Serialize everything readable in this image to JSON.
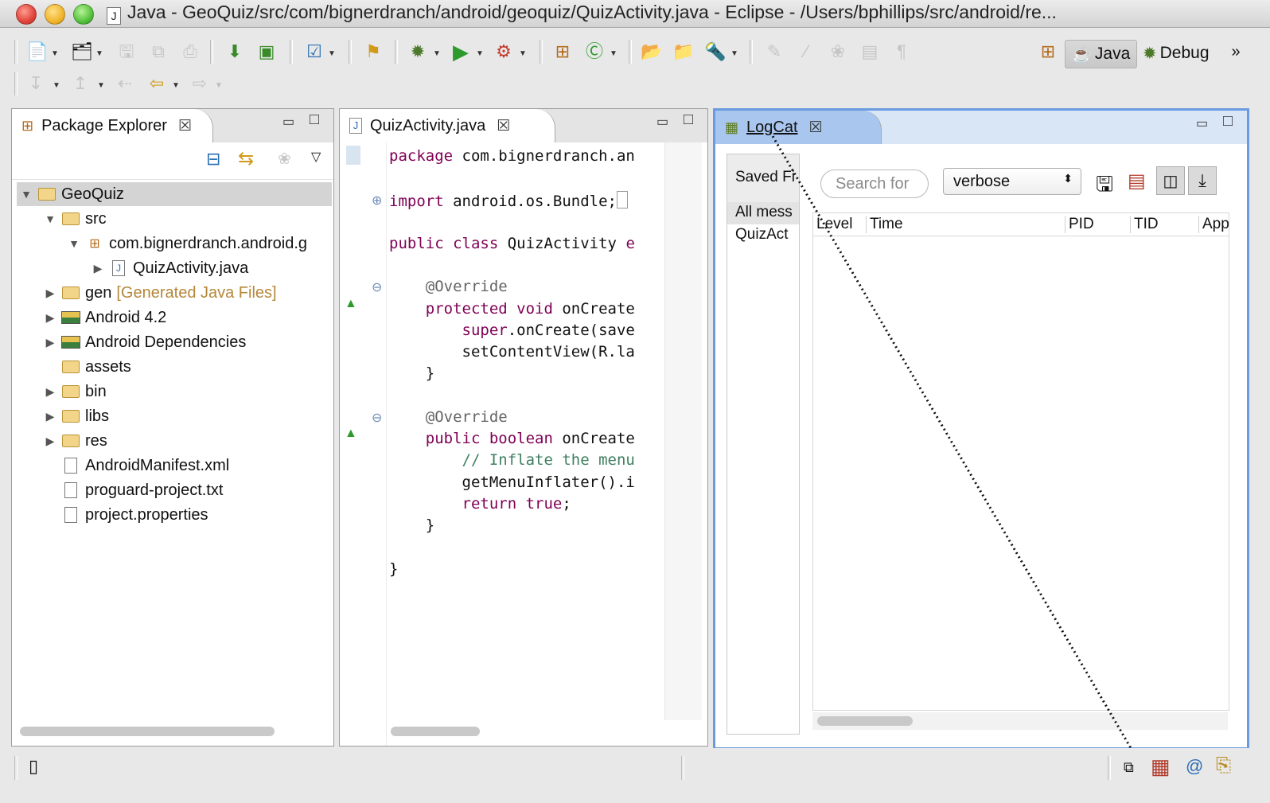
{
  "window": {
    "title": "Java - GeoQuiz/src/com/bignerdranch/android/geoquiz/QuizActivity.java - Eclipse -  /Users/bphillips/src/android/re..."
  },
  "perspectives": [
    {
      "label": "Java",
      "active": true
    },
    {
      "label": "Debug",
      "active": false
    }
  ],
  "perspective_overflow": "»",
  "package_explorer": {
    "tab_label": "Package Explorer",
    "tree": [
      {
        "label": "GeoQuiz",
        "depth": 0,
        "expanded": true,
        "icon": "project-icon",
        "selected": true
      },
      {
        "label": "src",
        "depth": 1,
        "expanded": true,
        "icon": "source-folder-icon"
      },
      {
        "label": "com.bignerdranch.android.g",
        "depth": 2,
        "expanded": true,
        "icon": "package-icon"
      },
      {
        "label": "QuizActivity.java",
        "depth": 3,
        "expanded": false,
        "icon": "java-file-icon"
      },
      {
        "label": "gen",
        "suffix": "[Generated Java Files]",
        "depth": 1,
        "expanded": false,
        "icon": "source-folder-icon"
      },
      {
        "label": "Android 4.2",
        "depth": 1,
        "expanded": false,
        "icon": "library-icon"
      },
      {
        "label": "Android Dependencies",
        "depth": 1,
        "expanded": false,
        "icon": "library-icon"
      },
      {
        "label": "assets",
        "depth": 1,
        "leaf": true,
        "icon": "folder-icon"
      },
      {
        "label": "bin",
        "depth": 1,
        "expanded": false,
        "icon": "folder-icon"
      },
      {
        "label": "libs",
        "depth": 1,
        "expanded": false,
        "icon": "folder-icon"
      },
      {
        "label": "res",
        "depth": 1,
        "expanded": false,
        "icon": "folder-icon"
      },
      {
        "label": "AndroidManifest.xml",
        "depth": 1,
        "leaf": true,
        "icon": "xml-file-icon"
      },
      {
        "label": "proguard-project.txt",
        "depth": 1,
        "leaf": true,
        "icon": "text-file-icon"
      },
      {
        "label": "project.properties",
        "depth": 1,
        "leaf": true,
        "icon": "text-file-icon"
      }
    ]
  },
  "editor": {
    "tab_label": "QuizActivity.java",
    "lines": [
      {
        "parts": [
          {
            "t": "package ",
            "c": "kw"
          },
          {
            "t": "com.bignerdranch.an",
            "c": ""
          }
        ],
        "marker": ""
      },
      {
        "parts": [
          {
            "t": "import ",
            "c": "kw"
          },
          {
            "t": "android.os.Bundle;",
            "c": ""
          }
        ],
        "marker": "plus"
      },
      {
        "parts": [
          {
            "t": "public class ",
            "c": "kw"
          },
          {
            "t": "QuizActivity ",
            "c": ""
          },
          {
            "t": "e",
            "c": "kw"
          }
        ],
        "marker": ""
      },
      {
        "parts": [
          {
            "t": "    @Override",
            "c": "an"
          }
        ],
        "marker": "minus"
      },
      {
        "parts": [
          {
            "t": "    protected void ",
            "c": "kw"
          },
          {
            "t": "onCreate",
            "c": ""
          }
        ],
        "marker": "override"
      },
      {
        "parts": [
          {
            "t": "        super",
            "c": "kw"
          },
          {
            "t": ".onCreate(save",
            "c": ""
          }
        ],
        "marker": ""
      },
      {
        "parts": [
          {
            "t": "        setContentView(R.la",
            "c": ""
          }
        ],
        "marker": ""
      },
      {
        "parts": [
          {
            "t": "    }",
            "c": ""
          }
        ],
        "marker": ""
      },
      {
        "parts": [
          {
            "t": "    @Override",
            "c": "an"
          }
        ],
        "marker": "minus"
      },
      {
        "parts": [
          {
            "t": "    public boolean ",
            "c": "kw"
          },
          {
            "t": "onCreate",
            "c": ""
          }
        ],
        "marker": "override"
      },
      {
        "parts": [
          {
            "t": "        // Inflate the menu",
            "c": "cm"
          }
        ],
        "marker": ""
      },
      {
        "parts": [
          {
            "t": "        getMenuInflater().i",
            "c": ""
          }
        ],
        "marker": ""
      },
      {
        "parts": [
          {
            "t": "        return true",
            "c": "kw"
          },
          {
            "t": ";",
            "c": ""
          }
        ],
        "marker": ""
      },
      {
        "parts": [
          {
            "t": "    }",
            "c": ""
          }
        ],
        "marker": ""
      },
      {
        "parts": [
          {
            "t": "}",
            "c": ""
          }
        ],
        "marker": ""
      }
    ]
  },
  "logcat": {
    "tab_label": "LogCat",
    "saved_filters_label": "Saved Fi",
    "filters": [
      "All mess",
      "QuizAct"
    ],
    "search_placeholder": "Search for",
    "level_select": "verbose",
    "columns": [
      "Level",
      "Time",
      "PID",
      "TID",
      "App"
    ]
  },
  "colors": {
    "keyword": "#7f0055",
    "comment": "#3f7f5f",
    "annotation": "#646464",
    "active_view_border": "#6a9be0"
  }
}
